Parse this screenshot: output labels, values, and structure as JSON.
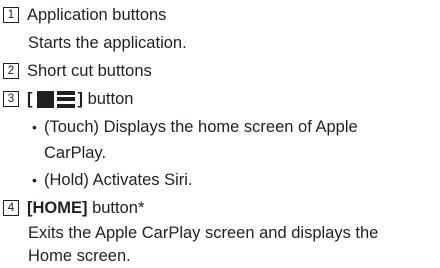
{
  "items": [
    {
      "number": "1",
      "title": "Application buttons",
      "description": "Starts the application."
    },
    {
      "number": "2",
      "title": "Short cut buttons"
    },
    {
      "number": "3",
      "title_open": "[",
      "title_close": "]",
      "title_suffix": " button",
      "icon": "carplay-home-button-icon",
      "bullets": [
        "(Touch) Displays the home screen of Apple",
        "CarPlay.",
        "(Hold) Activates Siri."
      ]
    },
    {
      "number": "4",
      "title_bold": "[HOME]",
      "title_suffix": " button*",
      "description_lines": [
        "Exits the Apple CarPlay screen and displays the",
        "Home screen."
      ]
    }
  ],
  "bullet_symbol": "•"
}
